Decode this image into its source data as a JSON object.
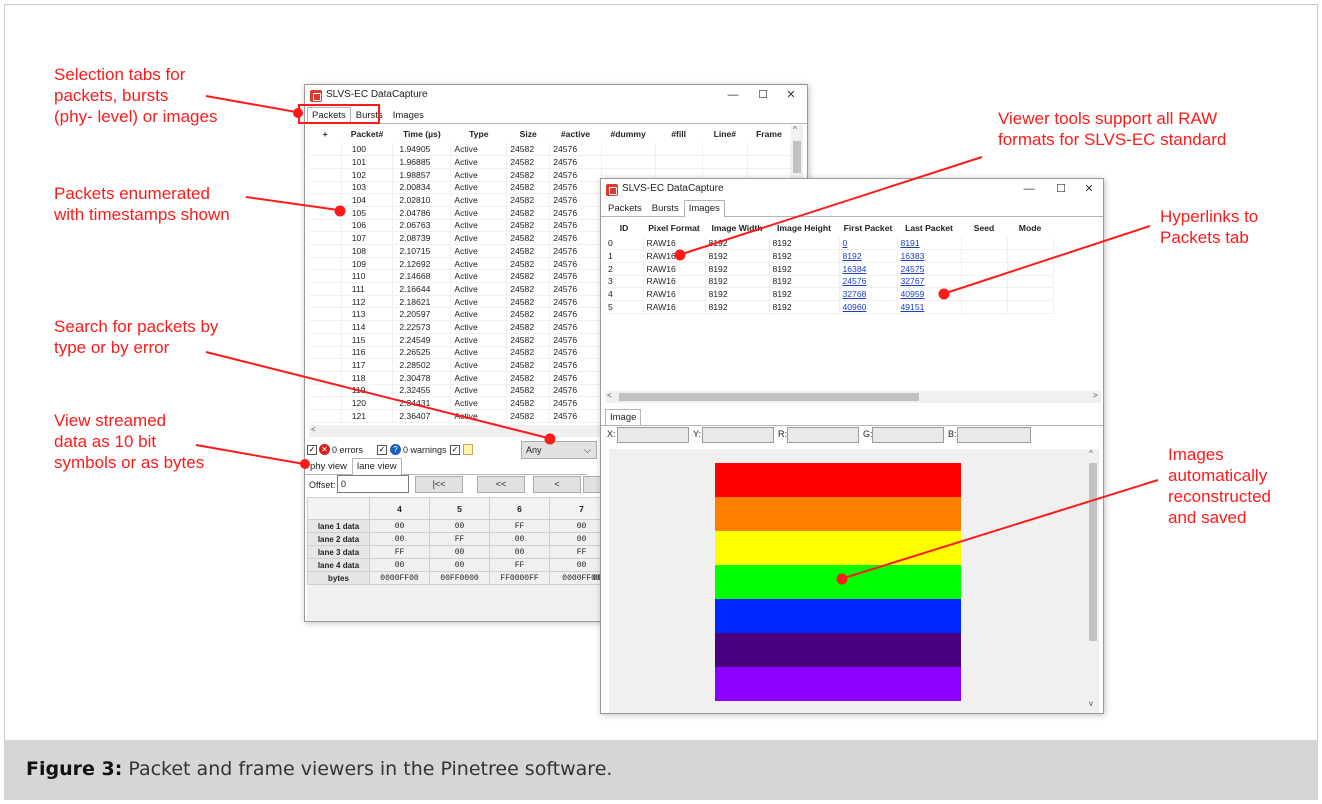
{
  "caption": {
    "label": "Figure 3:",
    "text": " Packet and frame viewers in the Pinetree software."
  },
  "annotations": {
    "selection_tabs": "Selection tabs for\npackets, bursts\n(phy- level) or images",
    "packets_enumerated": "Packets enumerated\nwith timestamps shown",
    "search": "Search for packets by\ntype or by error",
    "view_streamed": "View streamed\ndata as 10 bit\nsymbols or as bytes",
    "viewer_tools": "Viewer tools support all RAW\nformats for SLVS-EC standard",
    "hyperlinks": "Hyperlinks to\nPackets tab",
    "images_auto": "Images\nautomatically\nreconstructed\nand saved"
  },
  "annotation_color": "#ff1a1a",
  "packets_window": {
    "title": "SLVS-EC DataCapture",
    "tabs": [
      "Packets",
      "Bursts",
      "Images"
    ],
    "columns": [
      "+",
      "Packet#",
      "Time (µs)",
      "Type",
      "Size",
      "#active",
      "#dummy",
      "#fill",
      "Line#",
      "Frame"
    ],
    "rows": [
      [
        "100",
        "1.94905",
        "Active",
        "24582",
        "24576"
      ],
      [
        "101",
        "1.96885",
        "Active",
        "24582",
        "24576"
      ],
      [
        "102",
        "1.98857",
        "Active",
        "24582",
        "24576"
      ],
      [
        "103",
        "2.00834",
        "Active",
        "24582",
        "24576"
      ],
      [
        "104",
        "2.02810",
        "Active",
        "24582",
        "24576"
      ],
      [
        "105",
        "2.04786",
        "Active",
        "24582",
        "24576"
      ],
      [
        "106",
        "2.06763",
        "Active",
        "24582",
        "24576"
      ],
      [
        "107",
        "2.08739",
        "Active",
        "24582",
        "24576"
      ],
      [
        "108",
        "2.10715",
        "Active",
        "24582",
        "24576"
      ],
      [
        "109",
        "2.12692",
        "Active",
        "24582",
        "24576"
      ],
      [
        "110",
        "2.14668",
        "Active",
        "24582",
        "24576"
      ],
      [
        "111",
        "2.16644",
        "Active",
        "24582",
        "24576"
      ],
      [
        "112",
        "2.18621",
        "Active",
        "24582",
        "24576"
      ],
      [
        "113",
        "2.20597",
        "Active",
        "24582",
        "24576"
      ],
      [
        "114",
        "2.22573",
        "Active",
        "24582",
        "24576"
      ],
      [
        "115",
        "2.24549",
        "Active",
        "24582",
        "24576"
      ],
      [
        "116",
        "2.26525",
        "Active",
        "24582",
        "24576"
      ],
      [
        "117",
        "2.28502",
        "Active",
        "24582",
        "24576"
      ],
      [
        "118",
        "2.30478",
        "Active",
        "24582",
        "24576"
      ],
      [
        "119",
        "2.32455",
        "Active",
        "24582",
        "24576"
      ],
      [
        "120",
        "2.34431",
        "Active",
        "24582",
        "24576"
      ],
      [
        "121",
        "2.36407",
        "Active",
        "24582",
        "24576"
      ]
    ],
    "errors_label": "0 errors",
    "warnings_label": "0 warnings",
    "filter_value": "Any",
    "view_tabs": [
      "phy view",
      "lane view"
    ],
    "offset_label": "Offset:",
    "offset_value": "0",
    "nav_buttons": [
      "|<<",
      "<<",
      "<"
    ],
    "lane_columns": [
      "4",
      "5",
      "6",
      "7"
    ],
    "lane_rows": [
      {
        "label": "lane 1 data",
        "values": [
          "00",
          "00",
          "FF",
          "00"
        ]
      },
      {
        "label": "lane 2 data",
        "values": [
          "00",
          "FF",
          "00",
          "00"
        ]
      },
      {
        "label": "lane 3 data",
        "values": [
          "FF",
          "00",
          "00",
          "FF"
        ]
      },
      {
        "label": "lane 4 data",
        "values": [
          "00",
          "00",
          "FF",
          "00"
        ]
      },
      {
        "label": "bytes",
        "values": [
          "0000FF00",
          "00FF0000",
          "FF0000FF",
          "0000FF00"
        ]
      }
    ],
    "bytes_overflow": "00"
  },
  "images_window": {
    "title": "SLVS-EC DataCapture",
    "tabs": [
      "Packets",
      "Bursts",
      "Images"
    ],
    "columns": [
      "ID",
      "Pixel Format",
      "Image Width",
      "Image Height",
      "First Packet",
      "Last Packet",
      "Seed",
      "Mode"
    ],
    "rows": [
      [
        "0",
        "RAW16",
        "8192",
        "8192",
        "0",
        "8191"
      ],
      [
        "1",
        "RAW16",
        "8192",
        "8192",
        "8192",
        "16383"
      ],
      [
        "2",
        "RAW16",
        "8192",
        "8192",
        "16384",
        "24575"
      ],
      [
        "3",
        "RAW16",
        "8192",
        "8192",
        "24576",
        "32767"
      ],
      [
        "4",
        "RAW16",
        "8192",
        "8192",
        "32768",
        "40959"
      ],
      [
        "5",
        "RAW16",
        "8192",
        "8192",
        "40960",
        "49151"
      ]
    ],
    "image_tab": "Image",
    "coord_labels": [
      "X:",
      "Y:",
      "R:",
      "G:",
      "B:"
    ],
    "stripe_colors": [
      "#ff0000",
      "#ff8000",
      "#ffff00",
      "#00ff00",
      "#0026ff",
      "#4b0082",
      "#8b00ff"
    ]
  }
}
